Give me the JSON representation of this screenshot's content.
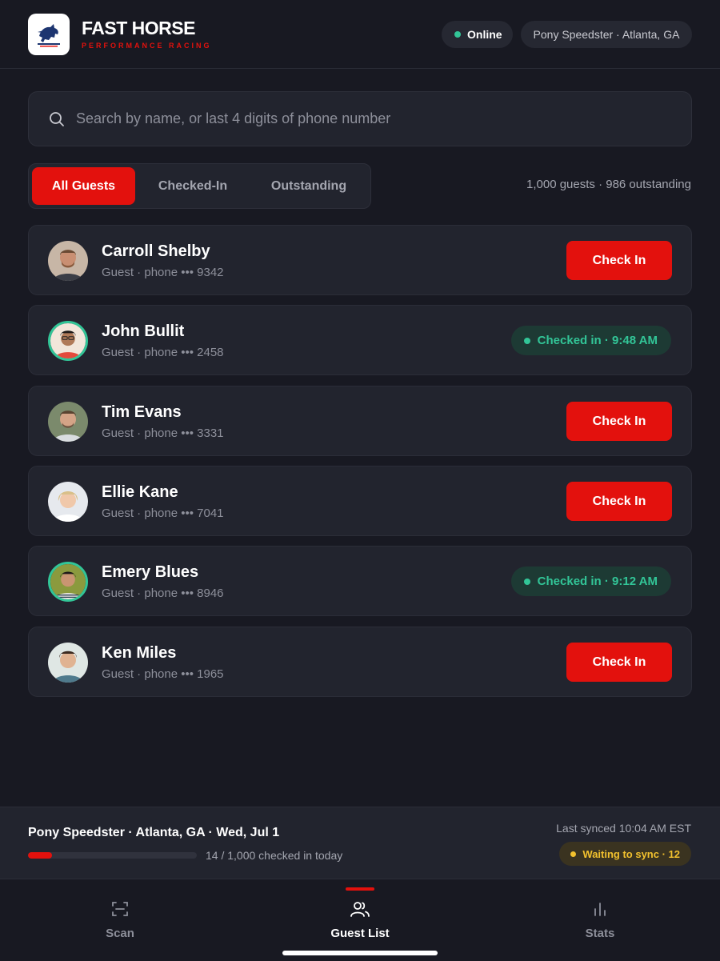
{
  "header": {
    "brand_title": "FAST HORSE",
    "brand_subtitle": "PERFORMANCE RACING",
    "status_label": "Online",
    "location_label": "Pony Speedster · Atlanta, GA"
  },
  "search": {
    "placeholder": "Search by name, or last 4 digits of phone number",
    "value": ""
  },
  "filters": {
    "tabs": [
      {
        "label": "All Guests",
        "active": true
      },
      {
        "label": "Checked-In",
        "active": false
      },
      {
        "label": "Outstanding",
        "active": false
      }
    ],
    "summary": "1,000 guests · 986 outstanding"
  },
  "guests": [
    {
      "name": "Carroll Shelby",
      "meta": "Guest · phone ••• 9342",
      "status": "outstanding",
      "action_label": "Check In"
    },
    {
      "name": "John Bullit",
      "meta": "Guest · phone ••• 2458",
      "status": "checked_in",
      "checked_label": "Checked in · 9:48 AM"
    },
    {
      "name": "Tim Evans",
      "meta": "Guest · phone ••• 3331",
      "status": "outstanding",
      "action_label": "Check In"
    },
    {
      "name": "Ellie Kane",
      "meta": "Guest · phone ••• 7041",
      "status": "outstanding",
      "action_label": "Check In"
    },
    {
      "name": "Emery Blues",
      "meta": "Guest · phone ••• 8946",
      "status": "checked_in",
      "checked_label": "Checked in · 9:12 AM"
    },
    {
      "name": "Ken Miles",
      "meta": "Guest · phone ••• 1965",
      "status": "outstanding",
      "action_label": "Check In"
    }
  ],
  "status_bar": {
    "event_line": "Pony Speedster · Atlanta, GA · Wed, Jul 1",
    "progress_text": "14 / 1,000 checked in today",
    "progress_fraction": 0.014,
    "last_synced": "Last synced 10:04 AM EST",
    "sync_pending": "Waiting to sync · 12"
  },
  "nav": {
    "items": [
      {
        "label": "Scan",
        "icon": "scan-icon",
        "active": false
      },
      {
        "label": "Guest List",
        "icon": "users-icon",
        "active": true
      },
      {
        "label": "Stats",
        "icon": "bar-chart-icon",
        "active": false
      }
    ]
  },
  "colors": {
    "background": "#181922",
    "card": "#22242e",
    "accent_red": "#e3110d",
    "success_green": "#32c597",
    "warning_yellow": "#f2c12e"
  }
}
